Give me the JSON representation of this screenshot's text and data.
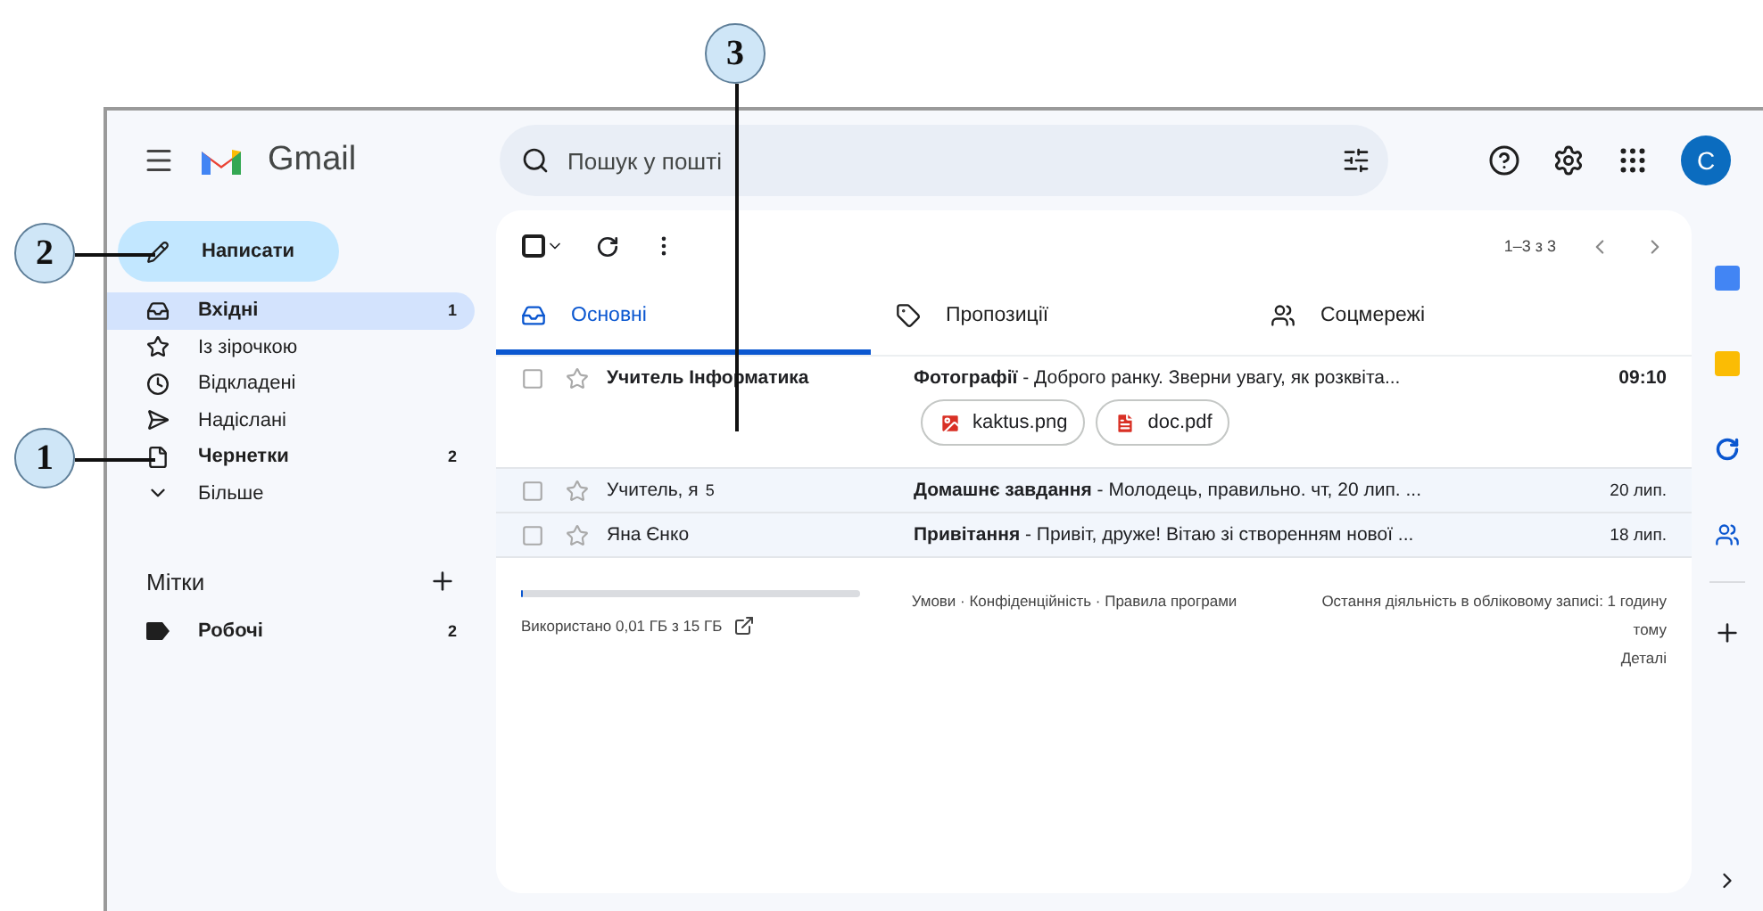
{
  "app": {
    "name": "Gmail",
    "search_placeholder": "Пошук у пошті",
    "avatar": "C"
  },
  "compose": "Написати",
  "sidebar": {
    "items": [
      {
        "kind": "inbox",
        "label": "Вхідні",
        "count": "1",
        "selected": true,
        "unread": true
      },
      {
        "kind": "star",
        "label": "Із зірочкою",
        "selected": false,
        "unread": false
      },
      {
        "kind": "clock",
        "label": "Відкладені",
        "selected": false,
        "unread": false
      },
      {
        "kind": "send",
        "label": "Надіслані",
        "selected": false,
        "unread": false
      },
      {
        "kind": "draft",
        "label": "Чернетки",
        "count": "2",
        "selected": false,
        "unread": true
      },
      {
        "kind": "more",
        "label": "Більше",
        "selected": false,
        "unread": false
      }
    ],
    "labels_title": "Мітки",
    "labels": [
      {
        "label": "Робочі",
        "count": "2",
        "unread": true
      }
    ]
  },
  "toolbar": {
    "select_all_checked": false,
    "range": "1–3 з 3"
  },
  "tabs": [
    {
      "kind": "primary",
      "label": "Основні",
      "selected": true
    },
    {
      "kind": "promotions",
      "label": "Пропозиції",
      "selected": false
    },
    {
      "kind": "social",
      "label": "Соцмережі",
      "selected": false
    }
  ],
  "emails": [
    {
      "sender": "Учитель Інформатика",
      "subject": "Фотографії",
      "snippet": " - Доброго ранку. Зверни увагу, як розквіта...",
      "time": "09:10",
      "unread": true,
      "attachments": [
        {
          "kind": "image",
          "name": "kaktus.png"
        },
        {
          "kind": "pdf",
          "name": "doc.pdf"
        }
      ]
    },
    {
      "sender": "Учитель, я",
      "count": "5",
      "subject": "Домашнє завдання",
      "snippet": " - Молодець, правильно. чт, 20 лип. ...",
      "time": "20 лип.",
      "unread": false
    },
    {
      "sender": "Яна Єнко",
      "subject": "Привітання",
      "snippet": " - Привіт, друже! Вітаю зі створенням нової ...",
      "time": "18 лип.",
      "unread": false
    }
  ],
  "footer": {
    "storage": {
      "level": 0.002,
      "text": "Використано 0,01 ГБ з 15 ГБ"
    },
    "terms": "Умови · Конфіденційність · Правила програми",
    "activity": "Остання діяльність в обліковому записі: 1 годину тому",
    "details": "Деталі"
  },
  "callouts": [
    {
      "label": "3"
    },
    {
      "label": "2"
    },
    {
      "label": "1"
    }
  ]
}
